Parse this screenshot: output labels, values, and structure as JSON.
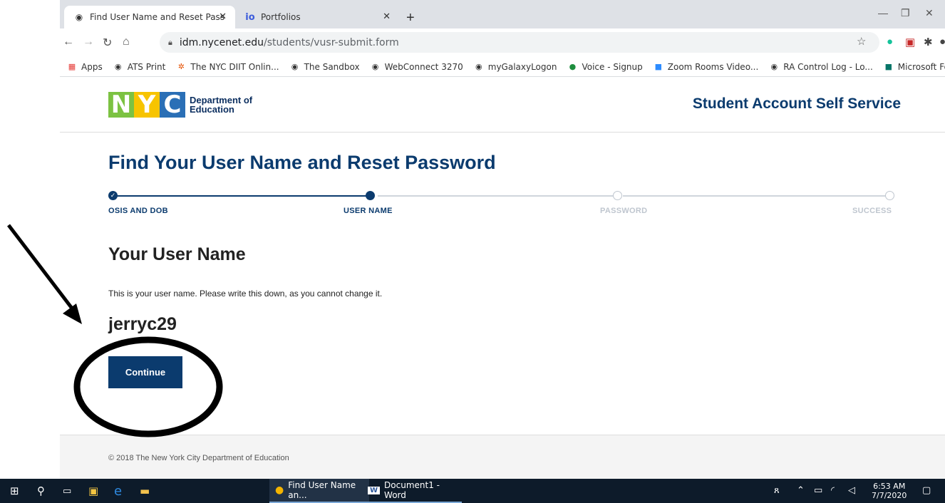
{
  "browser": {
    "tabs": [
      {
        "title": "Find User Name and Reset Passw",
        "close": "✕"
      },
      {
        "title": "Portfolios",
        "close": "✕"
      }
    ],
    "new_tab": "+",
    "url_host": "idm.nycenet.edu",
    "url_path": "/students/vusr-submit.form",
    "bookmarks": [
      "Apps",
      "ATS Print",
      "The NYC DIIT Onlin...",
      "The Sandbox",
      "WebConnect 3270",
      "myGalaxyLogon",
      "Voice - Signup",
      "Zoom Rooms Video...",
      "RA Control Log - Lo...",
      "Microsoft Forms"
    ],
    "bookmarks_overflow": "»"
  },
  "header": {
    "logo_text": "NYC",
    "department_line1": "Department of",
    "department_line2": "Education",
    "service_title": "Student Account Self Service"
  },
  "main": {
    "page_title": "Find Your User Name and Reset Password",
    "steps": [
      {
        "label": "OSIS AND DOB",
        "state": "complete"
      },
      {
        "label": "USER NAME",
        "state": "current"
      },
      {
        "label": "PASSWORD",
        "state": "pending"
      },
      {
        "label": "SUCCESS",
        "state": "pending"
      }
    ],
    "section_title": "Your User Name",
    "instructions": "This is your user name. Please write this down, as you cannot change it.",
    "username": "jerryc29",
    "continue_label": "Continue"
  },
  "footer": {
    "copyright": "© 2018 The New York City Department of Education"
  },
  "taskbar": {
    "apps": [
      {
        "label": "Find User Name an..."
      },
      {
        "label": "Document1 - Word"
      }
    ],
    "time": "6:53 AM",
    "date": "7/7/2020"
  },
  "colors": {
    "brand_navy": "#0b3b6e",
    "nyc_green": "#7cc242",
    "nyc_yellow": "#f7c400",
    "nyc_blue": "#2a6fb6"
  }
}
